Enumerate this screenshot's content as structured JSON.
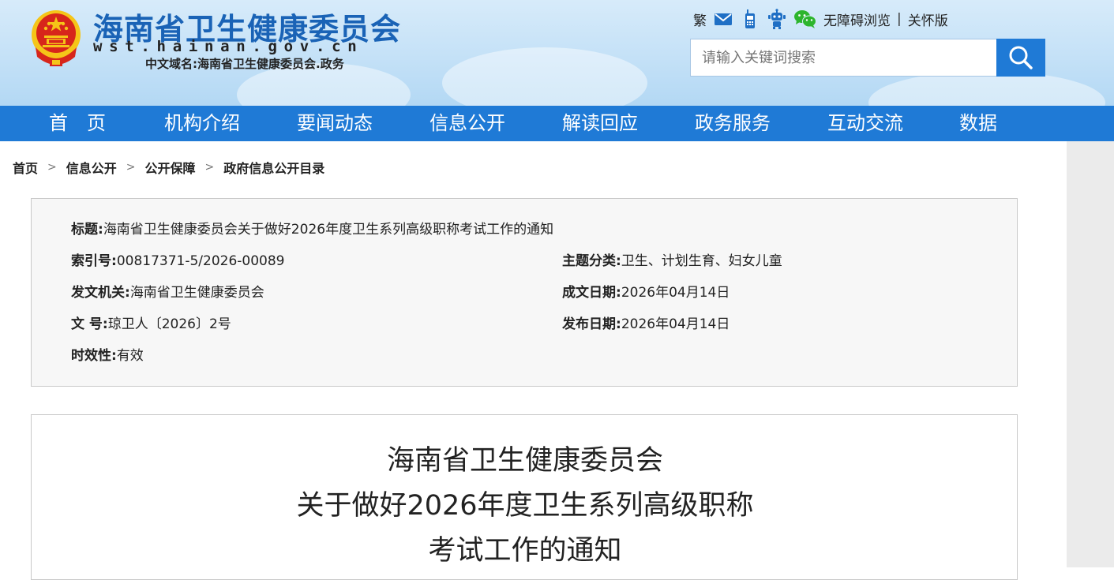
{
  "header": {
    "site_title": "海南省卫生健康委员会",
    "site_domain": "wst.hainan.gov.cn",
    "site_cn_domain": "中文域名:海南省卫生健康委员会.政务",
    "toolbar": {
      "traditional": "繁",
      "accessible": "无障碍浏览",
      "separator": "|",
      "care_mode": "关怀版"
    },
    "search": {
      "placeholder": "请输入关键词搜索"
    },
    "colors": {
      "brand_blue": "#1f7ad6",
      "title_blue": "#1a63b6",
      "wechat_green": "#2db52d",
      "emblem_red": "#d7261b",
      "emblem_gold": "#f5c518"
    }
  },
  "nav": {
    "items": [
      "首　页",
      "机构介绍",
      "要闻动态",
      "信息公开",
      "解读回应",
      "政务服务",
      "互动交流",
      "数据"
    ]
  },
  "breadcrumb": {
    "items": [
      "首页",
      "信息公开",
      "公开保障",
      "政府信息公开目录"
    ],
    "separator": ">"
  },
  "meta": {
    "title_label": "标题:",
    "title_value": "海南省卫生健康委员会关于做好2026年度卫生系列高级职称考试工作的通知",
    "index_label": "索引号:",
    "index_value": "00817371-5/2026-00089",
    "issuer_label": "发文机关:",
    "issuer_value": "海南省卫生健康委员会",
    "docno_label": "文 号:",
    "docno_value": "琼卫人〔2026〕2号",
    "validity_label": "时效性:",
    "validity_value": "有效",
    "topic_label": "主题分类:",
    "topic_value": "卫生、计划生育、妇女儿童",
    "created_label": "成文日期:",
    "created_value": "2026年04月14日",
    "published_label": "发布日期:",
    "published_value": "2026年04月14日"
  },
  "document": {
    "title_lines": [
      "海南省卫生健康委员会",
      "关于做好2026年度卫生系列高级职称",
      "考试工作的通知"
    ]
  }
}
